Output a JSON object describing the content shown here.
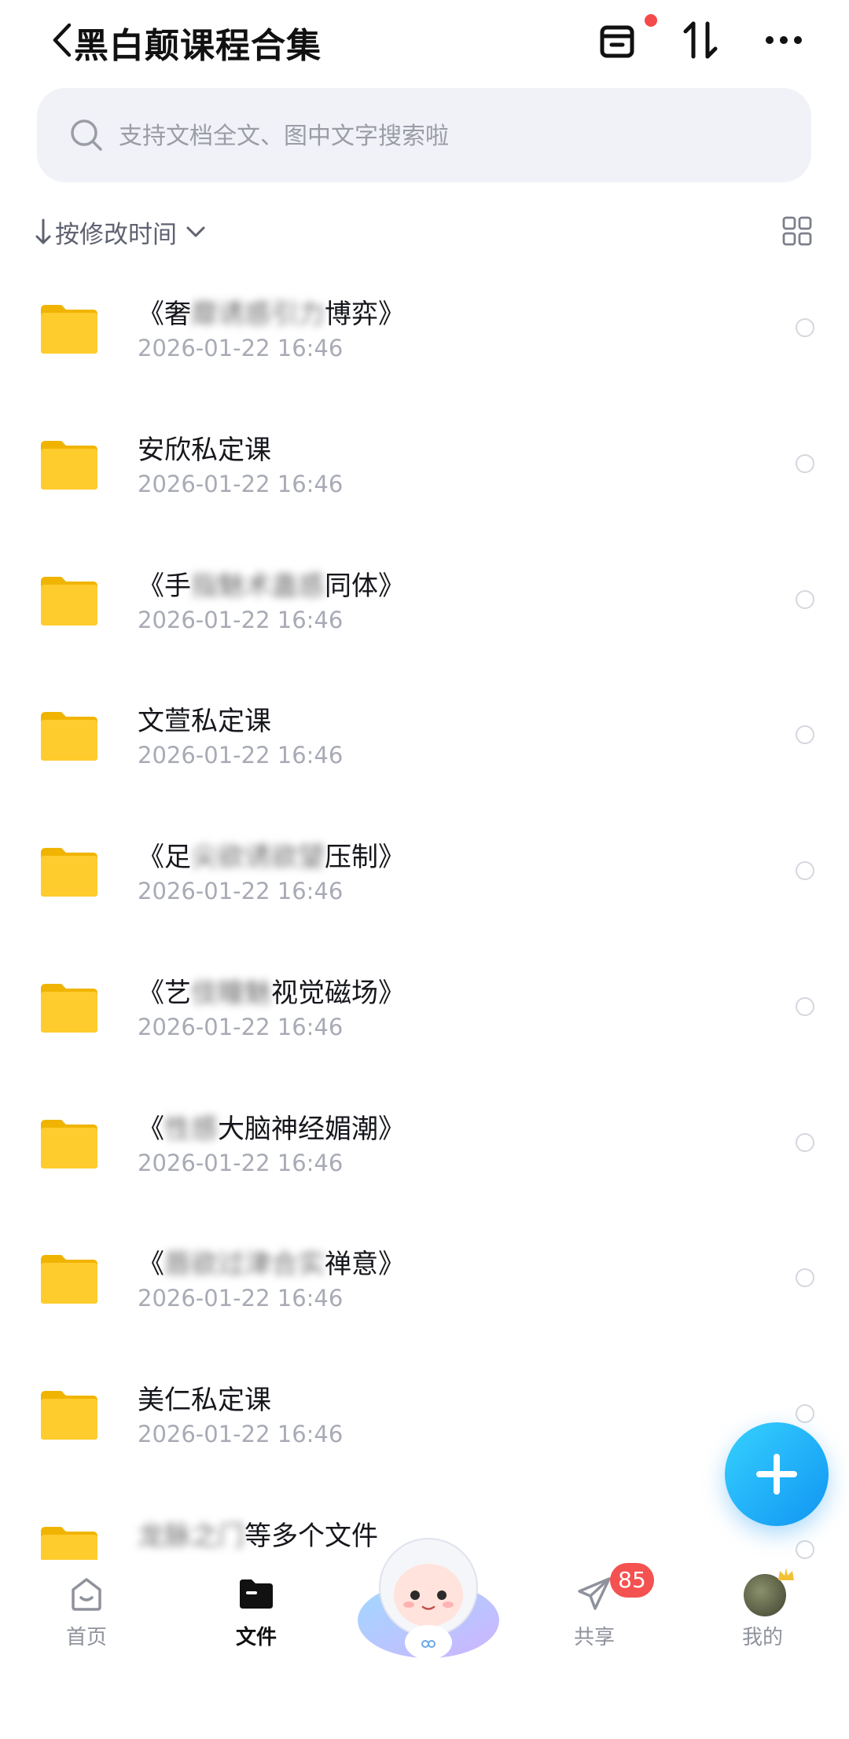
{
  "header": {
    "title": "黑白颠课程合集",
    "icons": [
      "back-icon",
      "transfer-box-icon",
      "sort-arrows-icon",
      "more-icon"
    ],
    "notify_color": "#f44a4a"
  },
  "search": {
    "placeholder": "支持文档全文、图中文字搜索啦"
  },
  "sort": {
    "label": "按修改时间"
  },
  "files": [
    {
      "prefix": "《奢",
      "blurred": "靡诱惑引力",
      "suffix": "博弈》",
      "time": "2026-01-22 16:46"
    },
    {
      "prefix": "安欣私定课",
      "blurred": "",
      "suffix": "",
      "time": "2026-01-22 16:46"
    },
    {
      "prefix": "《手",
      "blurred": "指魅术蛊惑",
      "suffix": "同体》",
      "time": "2026-01-22 16:46"
    },
    {
      "prefix": "文萱私定课",
      "blurred": "",
      "suffix": "",
      "time": "2026-01-22 16:46"
    },
    {
      "prefix": "《足",
      "blurred": "尖欲诱欲望",
      "suffix": "压制》",
      "time": "2026-01-22 16:46"
    },
    {
      "prefix": "《艺",
      "blurred": "伎瞳魅",
      "suffix": "视觉磁场》",
      "time": "2026-01-22 16:46"
    },
    {
      "prefix": "《",
      "blurred": "性感",
      "suffix": "大脑神经媚潮》",
      "time": "2026-01-22 16:46"
    },
    {
      "prefix": "《",
      "blurred": "唇欲过津合实",
      "suffix": "禅意》",
      "time": "2026-01-22 16:46"
    },
    {
      "prefix": "美仁私定课",
      "blurred": "",
      "suffix": "",
      "time": "2026-01-22 16:46"
    },
    {
      "prefix": "",
      "blurred": "龙脉之门",
      "suffix": "等多个文件",
      "time": ""
    }
  ],
  "nav": {
    "home": "首页",
    "files": "文件",
    "share": "共享",
    "share_badge": "85",
    "mine": "我的"
  },
  "colors": {
    "accent": "#1195f2",
    "folder": "#ffcc2e",
    "badge": "#f45151"
  }
}
